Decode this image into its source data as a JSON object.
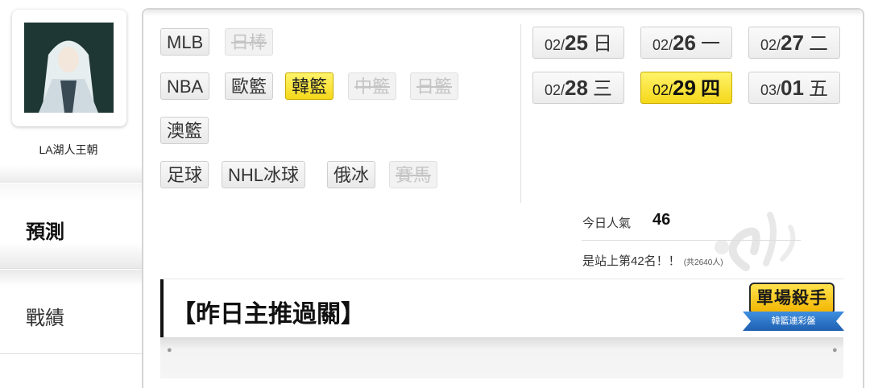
{
  "user": {
    "name": "LA湖人王朝"
  },
  "side_tabs": [
    {
      "label": "預測",
      "active": true
    },
    {
      "label": "戰績",
      "active": false
    }
  ],
  "leagues": [
    {
      "label": "MLB",
      "state": "normal"
    },
    {
      "label": "日棒",
      "state": "disabled"
    },
    {
      "label": "NBA",
      "state": "normal"
    },
    {
      "label": "歐籃",
      "state": "normal"
    },
    {
      "label": "韓籃",
      "state": "active"
    },
    {
      "label": "中籃",
      "state": "disabled"
    },
    {
      "label": "日籃",
      "state": "disabled"
    },
    {
      "label": "澳籃",
      "state": "normal"
    },
    {
      "label": "足球",
      "state": "normal"
    },
    {
      "label": "NHL冰球",
      "state": "normal"
    },
    {
      "label": "俄冰",
      "state": "normal"
    },
    {
      "label": "賽馬",
      "state": "disabled"
    }
  ],
  "dates": [
    {
      "month": "02/",
      "day": "25",
      "weekday": "日",
      "active": false
    },
    {
      "month": "02/",
      "day": "26",
      "weekday": "一",
      "active": false
    },
    {
      "month": "02/",
      "day": "27",
      "weekday": "二",
      "active": false
    },
    {
      "month": "02/",
      "day": "28",
      "weekday": "三",
      "active": false
    },
    {
      "month": "02/",
      "day": "29",
      "weekday": "四",
      "active": true
    },
    {
      "month": "03/",
      "day": "01",
      "weekday": "五",
      "active": false
    }
  ],
  "stats": {
    "popularity_label": "今日人氣",
    "popularity_value": "46",
    "rank_text": "是站上第42名！！",
    "rank_note": "(共2640人)"
  },
  "section": {
    "title": "【昨日主推過關】"
  },
  "badge": {
    "main": "單場殺手",
    "sub": "韓籃連彩盤"
  },
  "colors": {
    "accent_yellow": "#f5d81a",
    "badge_blue": "#1f5fb0"
  }
}
